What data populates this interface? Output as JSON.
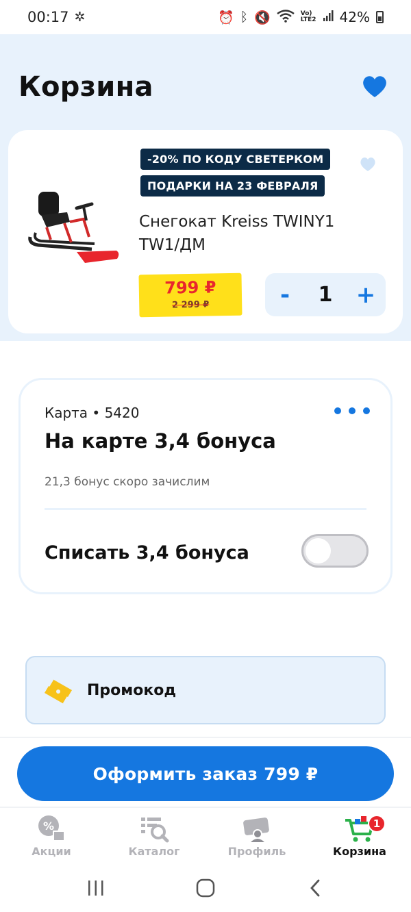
{
  "status_bar": {
    "time": "00:17",
    "battery": "42%",
    "lte_label_top": "Vo)",
    "lte_label_bottom": "LTE2"
  },
  "header": {
    "title": "Корзина"
  },
  "product": {
    "badges": [
      "-20% ПО КОДУ СВЕТЕРКОМ",
      "ПОДАРКИ НА 23 ФЕВРАЛЯ"
    ],
    "name": "Снегокат Kreiss TWINY1 TW1/ДМ",
    "price_new": "799 ₽",
    "price_old": "2 299 ₽",
    "quantity": "1",
    "minus": "-",
    "plus": "+"
  },
  "bonus": {
    "card_label": "Карта • 5420",
    "title": "На карте 3,4 бонуса",
    "note": "21,3 бонус скоро зачислим",
    "writeoff_label": "Списать 3,4 бонуса",
    "writeoff_enabled": false
  },
  "promo": {
    "label": "Промокод"
  },
  "checkout": {
    "label": "Оформить заказ 799 ₽"
  },
  "tabs": [
    {
      "label": "Акции",
      "icon": "percent-shop-icon"
    },
    {
      "label": "Каталог",
      "icon": "catalog-search-icon"
    },
    {
      "label": "Профиль",
      "icon": "profile-card-icon"
    },
    {
      "label": "Корзина",
      "icon": "cart-icon",
      "badge": "1",
      "active": true
    }
  ],
  "colors": {
    "accent": "#1577e0",
    "badge_bg": "#0c2b47",
    "price_tag": "#ffe01a",
    "price_red": "#e8262d",
    "header_bg": "#e8f2fc"
  }
}
